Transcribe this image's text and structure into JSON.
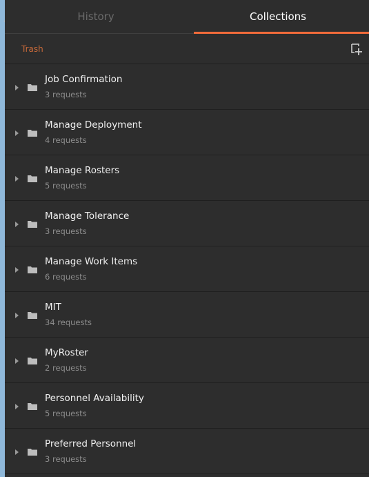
{
  "tabs": {
    "history_label": "History",
    "collections_label": "Collections"
  },
  "toolbar": {
    "trash_label": "Trash"
  },
  "collections": [
    {
      "name": "Job Confirmation",
      "count": "3 requests"
    },
    {
      "name": "Manage Deployment",
      "count": "4 requests"
    },
    {
      "name": "Manage Rosters",
      "count": "5 requests"
    },
    {
      "name": "Manage Tolerance",
      "count": "3 requests"
    },
    {
      "name": "Manage Work Items",
      "count": "6 requests"
    },
    {
      "name": "MIT",
      "count": "34 requests"
    },
    {
      "name": "MyRoster",
      "count": "2 requests"
    },
    {
      "name": "Personnel Availability",
      "count": "5 requests"
    },
    {
      "name": "Preferred Personnel",
      "count": "3 requests"
    }
  ],
  "colors": {
    "accent": "#f26b3a",
    "trash": "#c96a3a",
    "background": "#2d2d2d"
  }
}
